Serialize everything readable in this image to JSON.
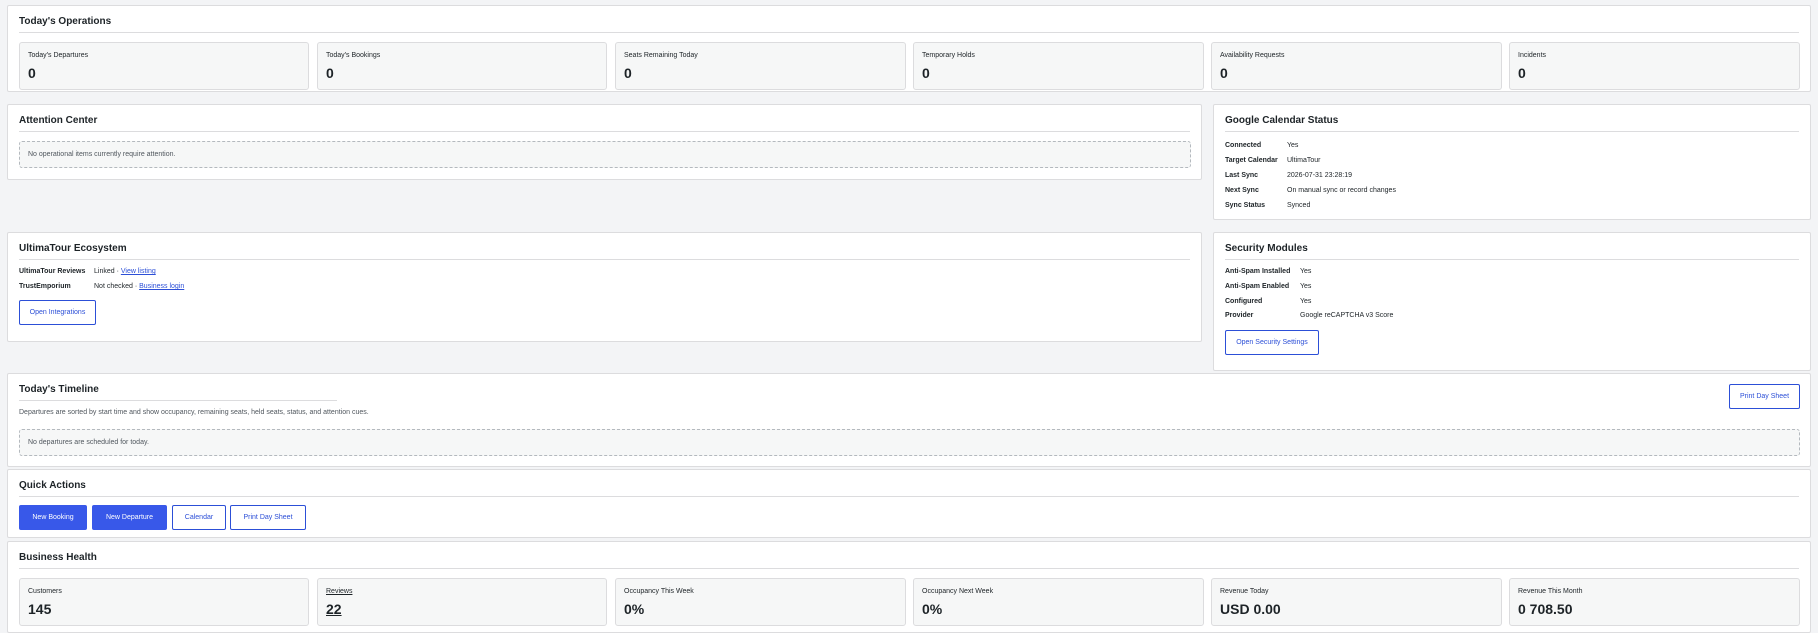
{
  "today_operations": {
    "title": "Today's Operations",
    "stats": [
      {
        "label": "Today's Departures",
        "value": "0"
      },
      {
        "label": "Today's Bookings",
        "value": "0"
      },
      {
        "label": "Seats Remaining Today",
        "value": "0"
      },
      {
        "label": "Temporary Holds",
        "value": "0"
      },
      {
        "label": "Availability Requests",
        "value": "0"
      },
      {
        "label": "Incidents",
        "value": "0"
      }
    ]
  },
  "attention_center": {
    "title": "Attention Center",
    "notice": "No operational items currently require attention."
  },
  "google_calendar": {
    "title": "Google Calendar Status",
    "rows": [
      {
        "key": "Connected",
        "value": "Yes"
      },
      {
        "key": "Target Calendar",
        "value": "UltimaTour"
      },
      {
        "key": "Last Sync",
        "value": "2026-07-31 23:28:19"
      },
      {
        "key": "Next Sync",
        "value": "On manual sync or record changes"
      },
      {
        "key": "Sync Status",
        "value": "Synced"
      }
    ]
  },
  "ecosystem": {
    "title": "UltimaTour Ecosystem",
    "rows": [
      {
        "key": "UltimaTour Reviews",
        "status": "Linked ·",
        "link": "View listing"
      },
      {
        "key": "TrustEmporium",
        "status": "Not checked ·",
        "link": "Business login"
      }
    ],
    "button": "Open Integrations"
  },
  "security": {
    "title": "Security Modules",
    "rows": [
      {
        "key": "Anti-Spam Installed",
        "value": "Yes"
      },
      {
        "key": "Anti-Spam Enabled",
        "value": "Yes"
      },
      {
        "key": "Configured",
        "value": "Yes"
      },
      {
        "key": "Provider",
        "value": "Google reCAPTCHA v3 Score"
      }
    ],
    "button": "Open Security Settings"
  },
  "timeline": {
    "title": "Today's Timeline",
    "description": "Departures are sorted by start time and show occupancy, remaining seats, held seats, status, and attention cues.",
    "notice": "No departures are scheduled for today.",
    "print_button": "Print Day Sheet"
  },
  "quick_actions": {
    "title": "Quick Actions",
    "buttons": {
      "new_booking": "New Booking",
      "new_departure": "New Departure",
      "calendar": "Calendar",
      "print_day_sheet": "Print Day Sheet"
    }
  },
  "business_health": {
    "title": "Business Health",
    "stats": [
      {
        "label": "Customers",
        "value": "145"
      },
      {
        "label": "Reviews",
        "value": "22"
      },
      {
        "label": "Occupancy This Week",
        "value": "0%"
      },
      {
        "label": "Occupancy Next Week",
        "value": "0%"
      },
      {
        "label": "Revenue Today",
        "value": "USD 0.00"
      },
      {
        "label": "Revenue This Month",
        "value": "0 708.50"
      }
    ]
  },
  "colors": {
    "accent": "#3858e9",
    "link": "#2c4fd7",
    "background": "#f3f4f6"
  }
}
